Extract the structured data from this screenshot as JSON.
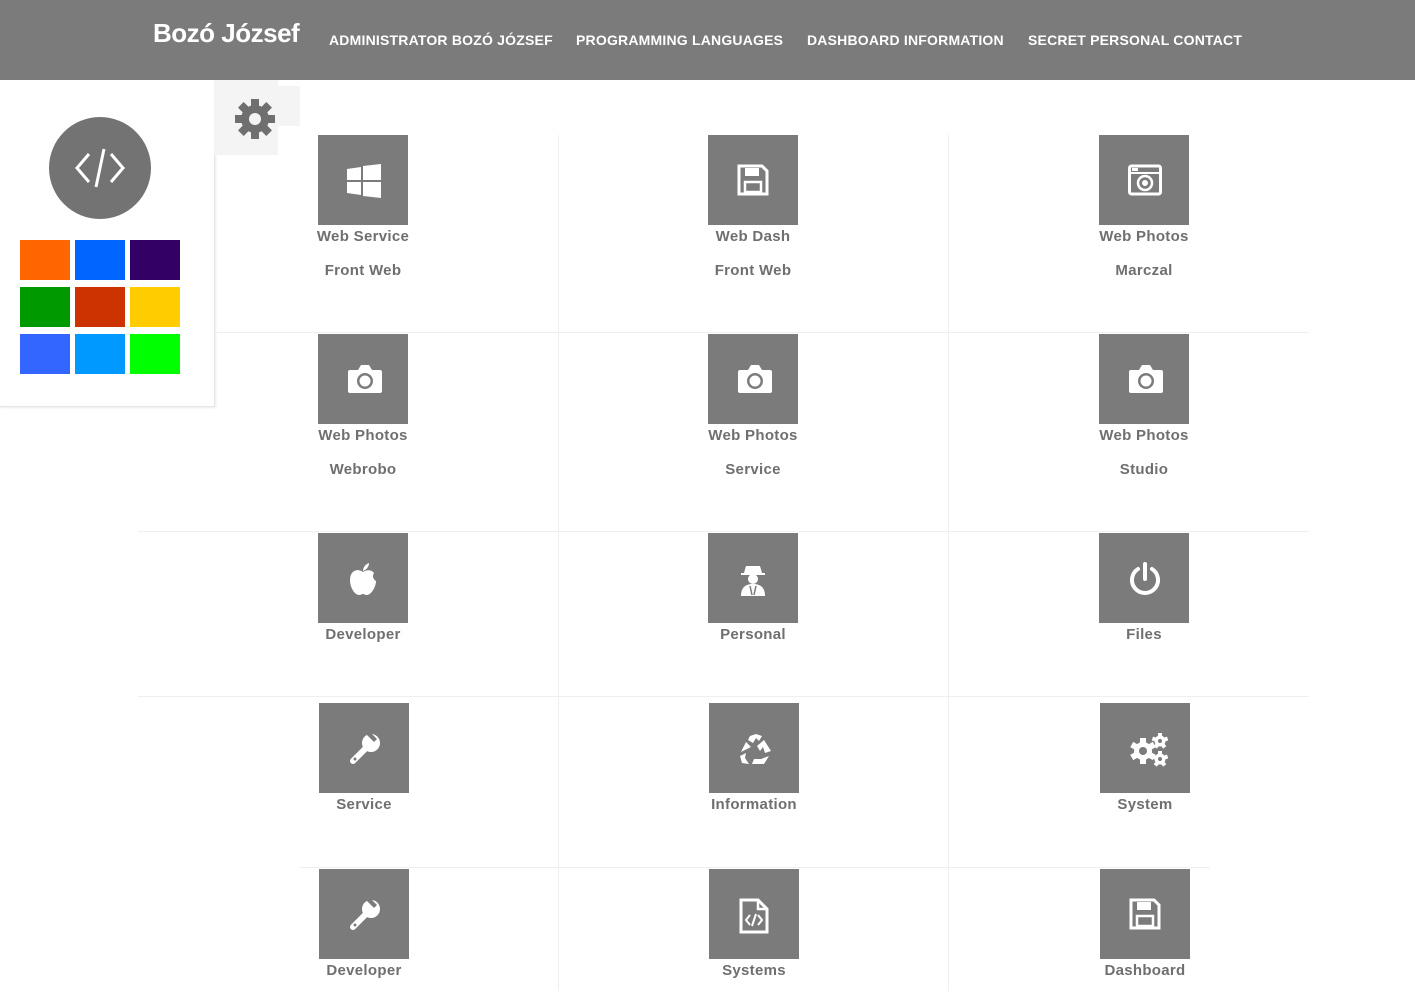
{
  "header": {
    "brand": "Bozó József",
    "nav": [
      {
        "label": "ADMINISTRATOR BOZÓ JÓZSEF"
      },
      {
        "label": "PROGRAMMING LANGUAGES"
      },
      {
        "label": "DASHBOARD INFORMATION"
      },
      {
        "label": "SECRET PERSONAL CONTACT"
      }
    ]
  },
  "panel": {
    "logo_icon": "code-icon",
    "swatches": [
      "#ff6600",
      "#0066ff",
      "#330066",
      "#009900",
      "#cc3300",
      "#ffcc00",
      "#3366ff",
      "#0099ff",
      "#00ff00"
    ]
  },
  "settings_icon": "gear-icon",
  "tiles": [
    {
      "icon": "windows-icon",
      "title": "Web Service",
      "subtitle": "Front Web"
    },
    {
      "icon": "floppy-disk-icon",
      "title": "Web Dash",
      "subtitle": "Front Web"
    },
    {
      "icon": "camera-retro-icon",
      "title": "Web Photos",
      "subtitle": "Marczal"
    },
    {
      "icon": "camera-icon",
      "title": "Web Photos",
      "subtitle": "Webrobo"
    },
    {
      "icon": "camera-icon",
      "title": "Web Photos",
      "subtitle": "Service"
    },
    {
      "icon": "camera-icon",
      "title": "Web Photos",
      "subtitle": "Studio"
    },
    {
      "icon": "apple-icon",
      "title": "Developer",
      "subtitle": ""
    },
    {
      "icon": "user-secret-icon",
      "title": "Personal",
      "subtitle": ""
    },
    {
      "icon": "power-icon",
      "title": "Files",
      "subtitle": ""
    },
    {
      "icon": "wrench-icon",
      "title": "Service",
      "subtitle": ""
    },
    {
      "icon": "recycle-icon",
      "title": "Information",
      "subtitle": ""
    },
    {
      "icon": "cogs-icon",
      "title": "System",
      "subtitle": ""
    },
    {
      "icon": "wrench-icon",
      "title": "Developer",
      "subtitle": ""
    },
    {
      "icon": "file-code-icon",
      "title": "Systems",
      "subtitle": ""
    },
    {
      "icon": "floppy-disk-icon",
      "title": "Dashboard",
      "subtitle": ""
    }
  ]
}
